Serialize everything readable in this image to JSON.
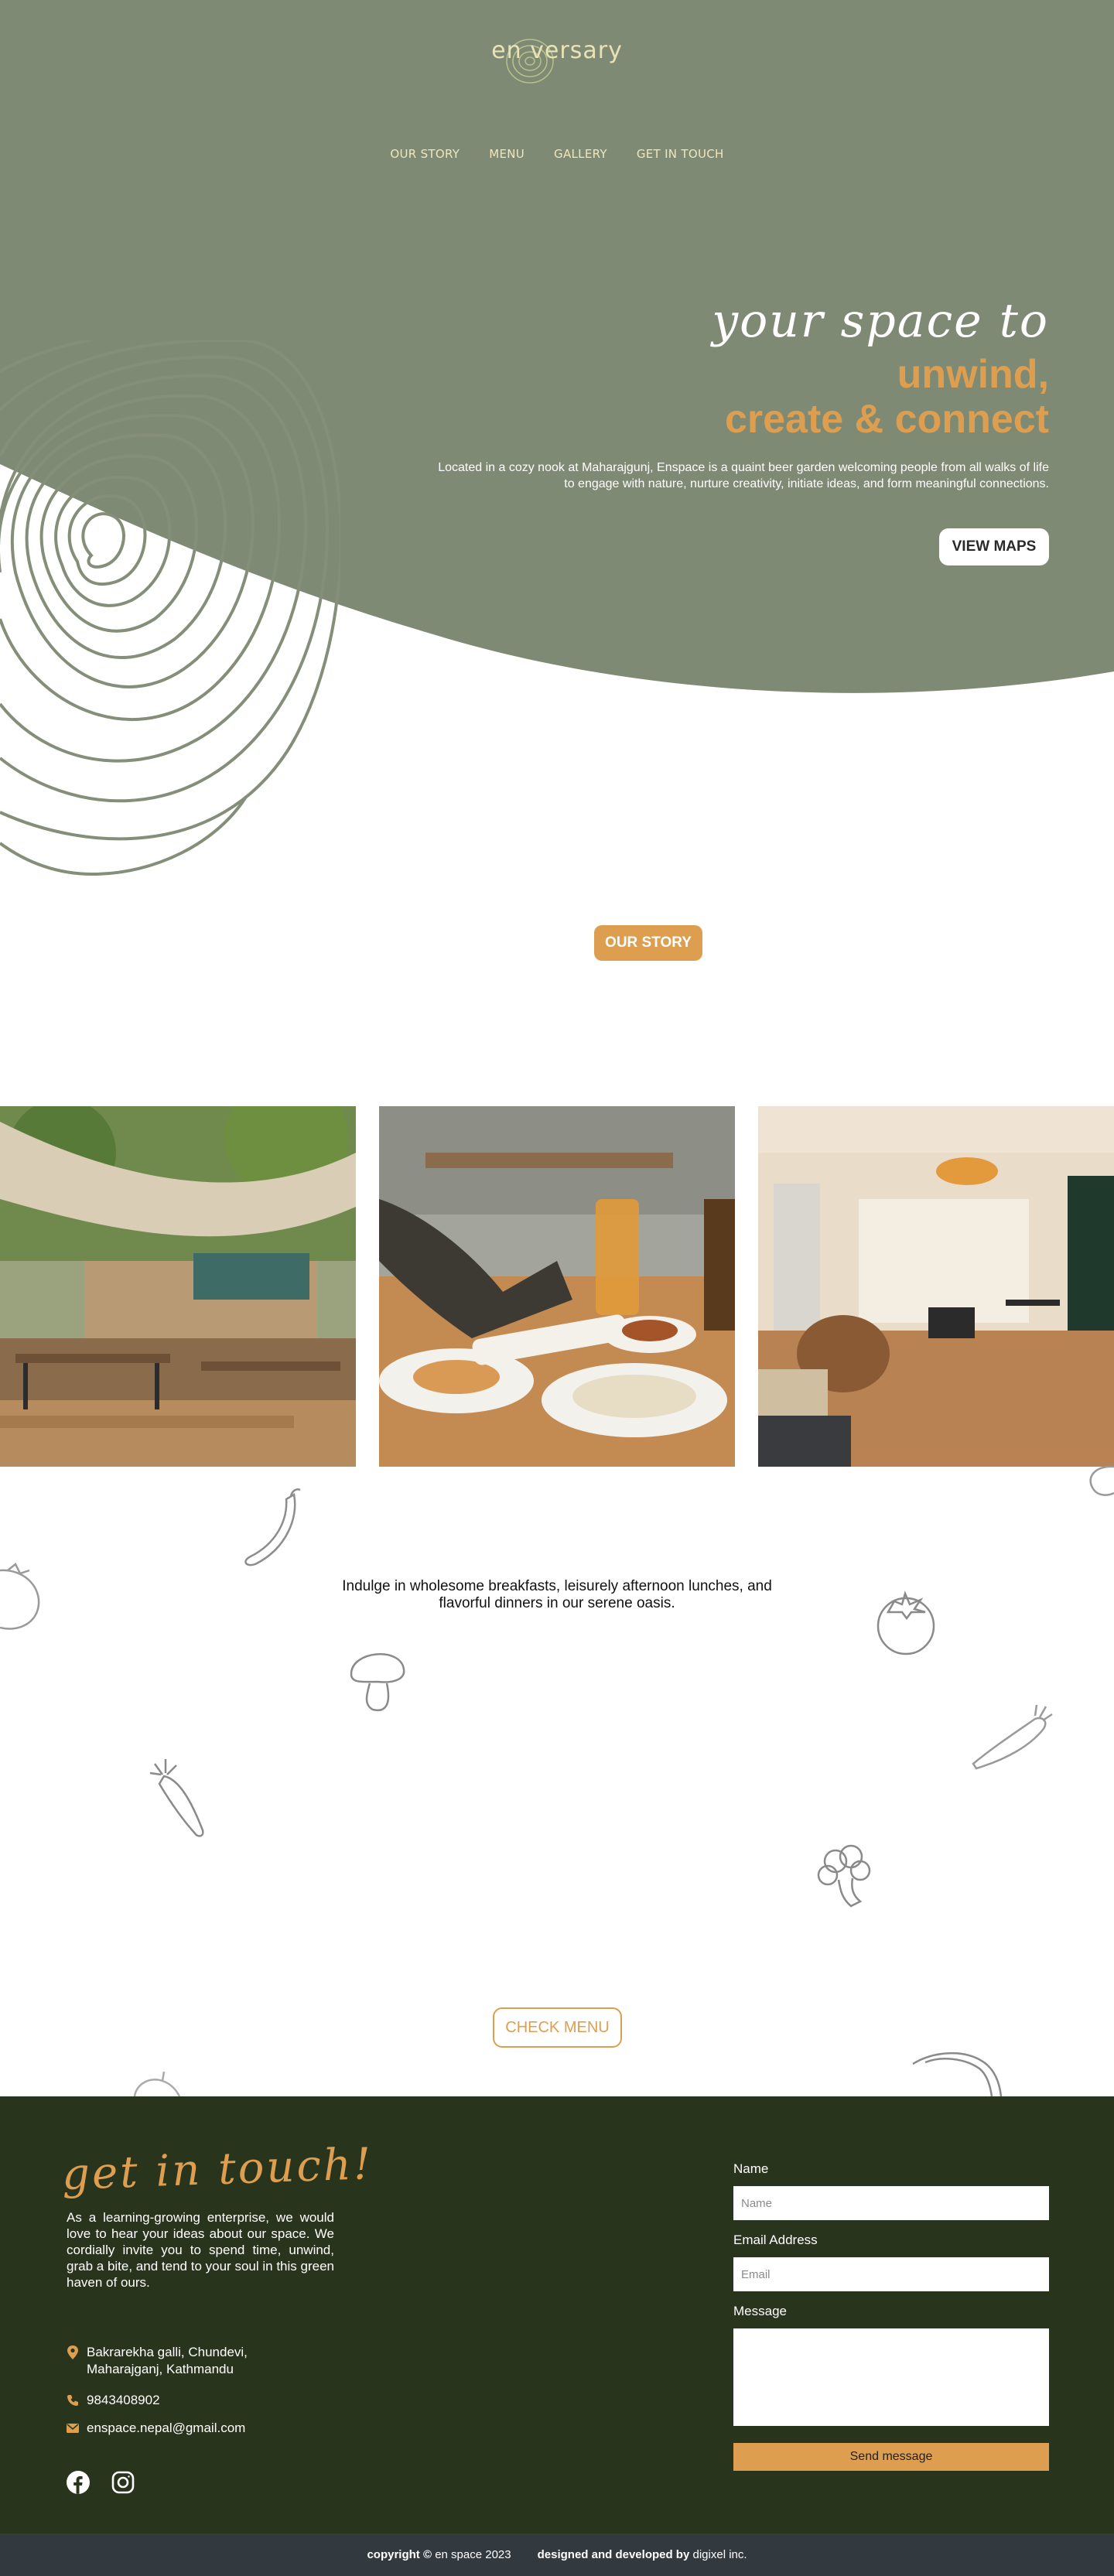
{
  "brand": {
    "logo_text": "en versary"
  },
  "nav": {
    "items": [
      "OUR STORY",
      "MENU",
      "GALLERY",
      "GET IN TOUCH"
    ]
  },
  "hero": {
    "script": "your space to",
    "headline_line1": "unwind,",
    "headline_line2": "create & connect",
    "description": "Located in a cozy nook at Maharajgunj, Enspace is a quaint beer garden welcoming people from all walks of life to engage with nature, nurture creativity, initiate ideas, and form meaningful connections.",
    "maps_button": "VIEW MAPS"
  },
  "story": {
    "button": "OUR STORY"
  },
  "menu": {
    "text": "Indulge in wholesome breakfasts, leisurely afternoon lunches, and flavorful dinners in our serene oasis.",
    "button": "CHECK MENU"
  },
  "contact": {
    "script_title": "get in touch!",
    "intro": "As a learning-growing enterprise, we would love to hear your ideas about our space. We cordially invite you to spend time, unwind, grab a bite, and tend to your soul in this green haven of ours.",
    "address_line1": "Bakrarekha galli, Chundevi,",
    "address_line2": "Maharajganj, Kathmandu",
    "phone": "9843408902",
    "email": "enspace.nepal@gmail.com",
    "form": {
      "name_label": "Name",
      "name_placeholder": "Name",
      "email_label": "Email Address",
      "email_placeholder": "Email",
      "message_label": "Message",
      "submit": "Send message"
    }
  },
  "footer": {
    "copyright_bold": "copyright ©",
    "copyright_text": "en space 2023",
    "credit_bold": "designed and developed by",
    "credit_text": "digixel inc."
  },
  "icons": [
    "location-pin-icon",
    "phone-icon",
    "envelope-icon",
    "facebook-icon",
    "instagram-icon"
  ],
  "colors": {
    "sage": "#7f8a74",
    "orange": "#dd9e4f",
    "forest": "#29341d",
    "footer_bar": "#323a40",
    "cream": "#e9e2b6"
  }
}
